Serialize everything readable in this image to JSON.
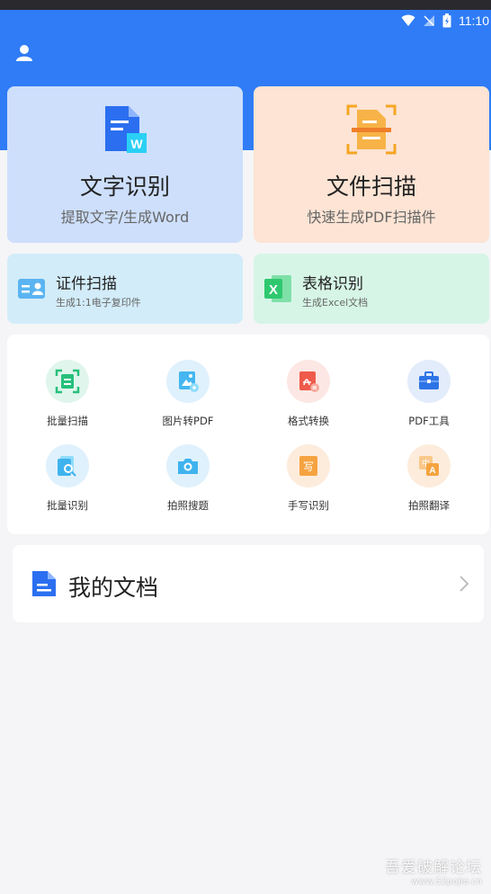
{
  "status_bar": {
    "time": "11:10"
  },
  "header": {
    "profile_icon": "user-icon"
  },
  "main_cards": [
    {
      "title": "文字识别",
      "subtitle": "提取文字/生成Word",
      "icon": "word-doc-icon"
    },
    {
      "title": "文件扫描",
      "subtitle": "快速生成PDF扫描件",
      "icon": "scan-doc-icon"
    }
  ],
  "small_cards": [
    {
      "title": "证件扫描",
      "subtitle": "生成1:1电子复印件",
      "icon": "id-card-icon"
    },
    {
      "title": "表格识别",
      "subtitle": "生成Excel文档",
      "icon": "excel-icon"
    }
  ],
  "tools": [
    {
      "label": "批量扫描",
      "icon": "batch-scan-icon"
    },
    {
      "label": "图片转PDF",
      "icon": "image-to-pdf-icon"
    },
    {
      "label": "格式转换",
      "icon": "format-convert-icon"
    },
    {
      "label": "PDF工具",
      "icon": "pdf-toolbox-icon"
    },
    {
      "label": "批量识别",
      "icon": "batch-recognize-icon"
    },
    {
      "label": "拍照搜题",
      "icon": "camera-icon"
    },
    {
      "label": "手写识别",
      "icon": "handwriting-icon"
    },
    {
      "label": "拍照翻译",
      "icon": "translate-icon"
    }
  ],
  "my_docs": {
    "label": "我的文档",
    "icon": "document-icon"
  },
  "watermark": {
    "line1": "吾爱破解论坛",
    "line2": "www.52pojie.cn"
  },
  "colors": {
    "header_blue": "#2f7cf6",
    "ocr_card": "#cddffb",
    "scan_card": "#fde4d4",
    "id_card": "#d2ecf9",
    "table_card": "#d6f5e7"
  }
}
